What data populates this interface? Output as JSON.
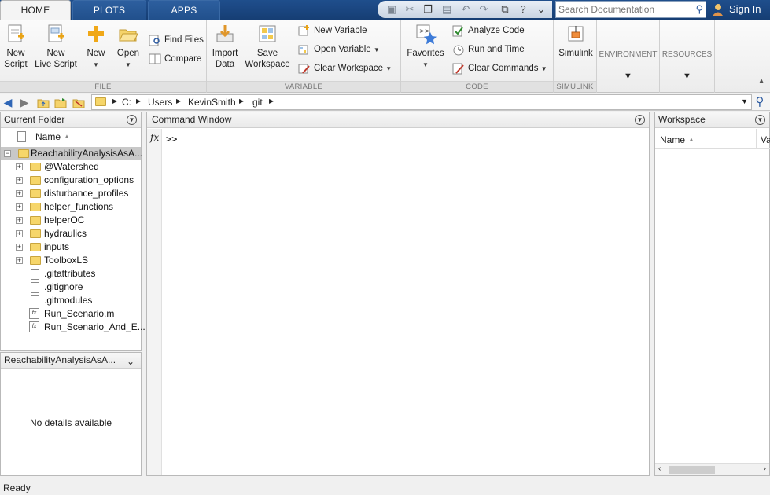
{
  "tabs": [
    {
      "label": "HOME",
      "active": true
    },
    {
      "label": "PLOTS",
      "active": false
    },
    {
      "label": "APPS",
      "active": false
    }
  ],
  "search": {
    "placeholder": "Search Documentation"
  },
  "signin_label": "Sign In",
  "toolstrip": {
    "file": {
      "label": "FILE",
      "new_script": "New\nScript",
      "new_live_script": "New\nLive Script",
      "new": "New",
      "open": "Open",
      "find_files": "Find Files",
      "compare": "Compare"
    },
    "variable": {
      "label": "VARIABLE",
      "import_data": "Import\nData",
      "save_workspace": "Save\nWorkspace",
      "new_variable": "New Variable",
      "open_variable": "Open Variable",
      "clear_workspace": "Clear Workspace"
    },
    "code": {
      "label": "CODE",
      "favorites": "Favorites",
      "analyze_code": "Analyze Code",
      "run_and_time": "Run and Time",
      "clear_commands": "Clear Commands"
    },
    "simulink": {
      "label": "SIMULINK",
      "simulink": "Simulink"
    },
    "environment": {
      "label": "ENVIRONMENT"
    },
    "resources": {
      "label": "RESOURCES"
    }
  },
  "path": [
    "C:",
    "Users",
    "KevinSmith",
    "git"
  ],
  "current_folder": {
    "title": "Current Folder",
    "column_name": "Name",
    "root": "ReachabilityAnalysisAsA...",
    "folders": [
      "@Watershed",
      "configuration_options",
      "disturbance_profiles",
      "helper_functions",
      "helperOC",
      "hydraulics",
      "inputs",
      "ToolboxLS"
    ],
    "files": [
      ".gitattributes",
      ".gitignore",
      ".gitmodules"
    ],
    "mfiles": [
      "Run_Scenario.m",
      "Run_Scenario_And_E..."
    ]
  },
  "details": {
    "title": "ReachabilityAnalysisAsA...",
    "message": "No details available"
  },
  "command_window": {
    "title": "Command Window",
    "fx": "fx",
    "prompt": ">>"
  },
  "workspace": {
    "title": "Workspace",
    "column_name": "Name",
    "column_value": "Va"
  },
  "status": "Ready"
}
